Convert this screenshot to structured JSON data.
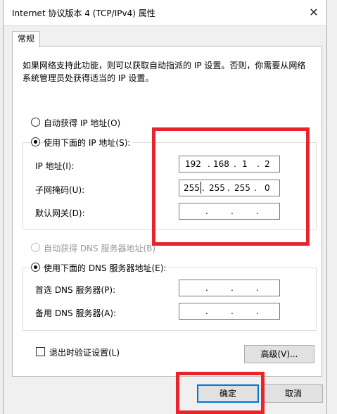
{
  "window": {
    "title": "Internet 协议版本 4 (TCP/IPv4) 属性",
    "close_glyph": "✕"
  },
  "tab": {
    "label": "常规"
  },
  "description": "如果网络支持此功能，则可以获取自动指派的 IP 设置。否则，你需要从网络系统管理员处获得适当的 IP 设置。",
  "ip_section": {
    "auto_label": "自动获得 IP 地址(O)",
    "manual_label": "使用下面的 IP 地址(S):",
    "ip_label": "IP 地址(I):",
    "ip_octets": [
      "192",
      "168",
      "1",
      "2"
    ],
    "subnet_label": "子网掩码(U):",
    "subnet_octets": [
      "255",
      "255",
      "255",
      "0"
    ],
    "gateway_label": "默认网关(D):",
    "gateway_octets": [
      "",
      "",
      "",
      ""
    ]
  },
  "dns_section": {
    "auto_label": "自动获得 DNS 服务器地址(B)",
    "manual_label": "使用下面的 DNS 服务器地址(E):",
    "preferred_label": "首选 DNS 服务器(P):",
    "preferred_octets": [
      "",
      "",
      "",
      ""
    ],
    "alternate_label": "备用 DNS 服务器(A):",
    "alternate_octets": [
      "",
      "",
      "",
      ""
    ]
  },
  "validate_label": "退出时验证设置(L)",
  "advanced_label": "高级(V)...",
  "ok_label": "确定",
  "cancel_label": "取消",
  "colors": {
    "highlight": "#e8232a",
    "focus": "#0078d7"
  }
}
